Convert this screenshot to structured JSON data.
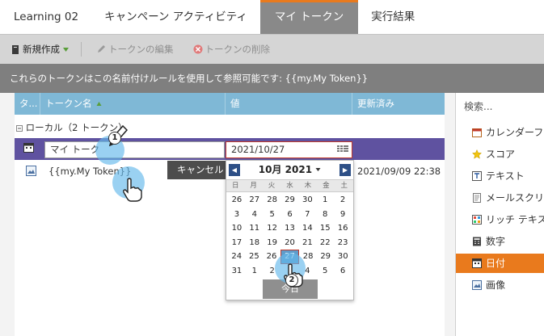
{
  "tabs": [
    {
      "label": "Learning 02",
      "active": false
    },
    {
      "label": "キャンペーン アクティビティ",
      "active": false
    },
    {
      "label": "マイ トークン",
      "active": true
    },
    {
      "label": "実行結果",
      "active": false
    }
  ],
  "toolbar": {
    "new_label": "新規作成",
    "edit_label": "トークンの編集",
    "delete_label": "トークンの削除"
  },
  "info_text": "これらのトークンはこの名前付けルールを使用して参照可能です: {{my.My Token}}",
  "grid": {
    "columns": [
      "タ...",
      "トークン名",
      "値",
      "更新済み"
    ],
    "group_label": "ローカル（2 トークン）",
    "editing_row": {
      "name_value": "マイ トーク",
      "date_value": "2021/10/27",
      "cancel_label": "キャンセル"
    },
    "row2": {
      "name": "{{my.My Token}}",
      "updated": "2021/09/09 22:38"
    }
  },
  "calendar": {
    "month_label": "10月 2021",
    "dow": [
      "日",
      "月",
      "火",
      "水",
      "木",
      "金",
      "土"
    ],
    "weeks": [
      [
        "26",
        "27",
        "28",
        "29",
        "30",
        "1",
        "2"
      ],
      [
        "3",
        "4",
        "5",
        "6",
        "7",
        "8",
        "9"
      ],
      [
        "10",
        "11",
        "12",
        "13",
        "14",
        "15",
        "16"
      ],
      [
        "17",
        "18",
        "19",
        "20",
        "21",
        "22",
        "23"
      ],
      [
        "24",
        "25",
        "26",
        "27",
        "28",
        "29",
        "30"
      ],
      [
        "31",
        "1",
        "2",
        "3",
        "4",
        "5",
        "6"
      ]
    ],
    "selected_day": "27",
    "today_label": "今日"
  },
  "panel": {
    "search_placeholder": "検索...",
    "items": [
      {
        "label": "カレンダーファイル",
        "icon": "calendar-icon"
      },
      {
        "label": "スコア",
        "icon": "star-icon"
      },
      {
        "label": "テキスト",
        "icon": "text-icon"
      },
      {
        "label": "メールスクリプト",
        "icon": "script-icon"
      },
      {
        "label": "リッチ テキスト",
        "icon": "rich-text-icon"
      },
      {
        "label": "数字",
        "icon": "number-icon"
      },
      {
        "label": "日付",
        "icon": "date-icon",
        "active": true
      },
      {
        "label": "画像",
        "icon": "image-icon"
      }
    ]
  },
  "steps": [
    "1",
    "2"
  ],
  "colors": {
    "accent": "#e97a1d",
    "selected_row": "#5f52a0",
    "header": "#7fb8d6",
    "calendar_nav": "#2d4f86",
    "pointer": "#64b9eb"
  }
}
